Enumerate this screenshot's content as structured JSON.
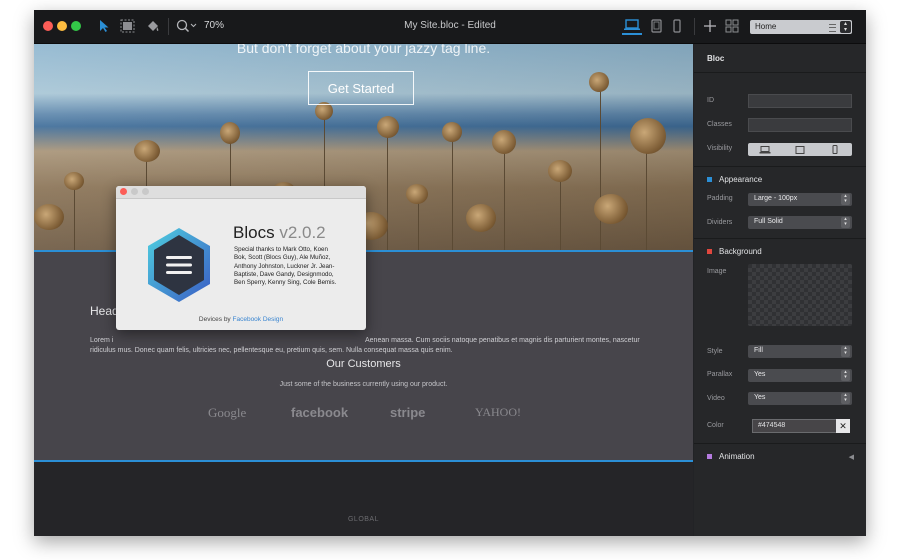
{
  "window": {
    "title": "My Site.bloc - Edited",
    "zoom": "70%",
    "page_select": "Home"
  },
  "canvas": {
    "hero_tagline": "But don't forget about your jazzy tag line.",
    "get_started": "Get Started",
    "heading_partial": "Head",
    "lorem_rows": [
      "Lorem i",
      "ridiculus mus. Donec quam felis, ultricies nec, pellentesque eu, pretium quis, sem. Nulla consequat massa quis enim."
    ],
    "lorem_right": "Aenean massa. Cum sociis natoque penatibus et magnis dis parturient montes, nascetur",
    "customers_title": "Our Customers",
    "customers_sub": "Just some of the business currently using our product.",
    "logos": [
      "Google",
      "facebook",
      "stripe",
      "YAHOO!"
    ],
    "global_label": "GLOBAL"
  },
  "about": {
    "name": "Blocs",
    "version": "v2.0.2",
    "credits": [
      "Special thanks to Mark Otto, Koen",
      "Bok, Scott (Blocs Guy), Ale Muñoz,",
      "Anthony Johnston, Luckner Jr. Jean-",
      "Baptiste, Dave Gandy, Designmodo,",
      "Ben Sperry, Kenny Sing, Cole Bemis."
    ],
    "footer_prefix": "Devices by",
    "footer_link": "Facebook Design"
  },
  "inspector": {
    "header": "Bloc",
    "id_label": "ID",
    "classes_label": "Classes",
    "visibility_label": "Visibility",
    "appearance": "Appearance",
    "padding_label": "Padding",
    "padding_value": "Large - 100px",
    "dividers_label": "Dividers",
    "dividers_value": "Full Solid",
    "background": "Background",
    "image_label": "Image",
    "style_label": "Style",
    "style_value": "Fill",
    "parallax_label": "Parallax",
    "parallax_value": "Yes",
    "video_label": "Video",
    "video_value": "Yes",
    "color_label": "Color",
    "color_value": "#474548",
    "animation": "Animation"
  },
  "colors": {
    "accent_blue": "#2b8fd6",
    "appearance_square": "#2b8fd6",
    "background_square": "#e0473e",
    "animation_square": "#b57be0",
    "section_bg": "#474548"
  }
}
